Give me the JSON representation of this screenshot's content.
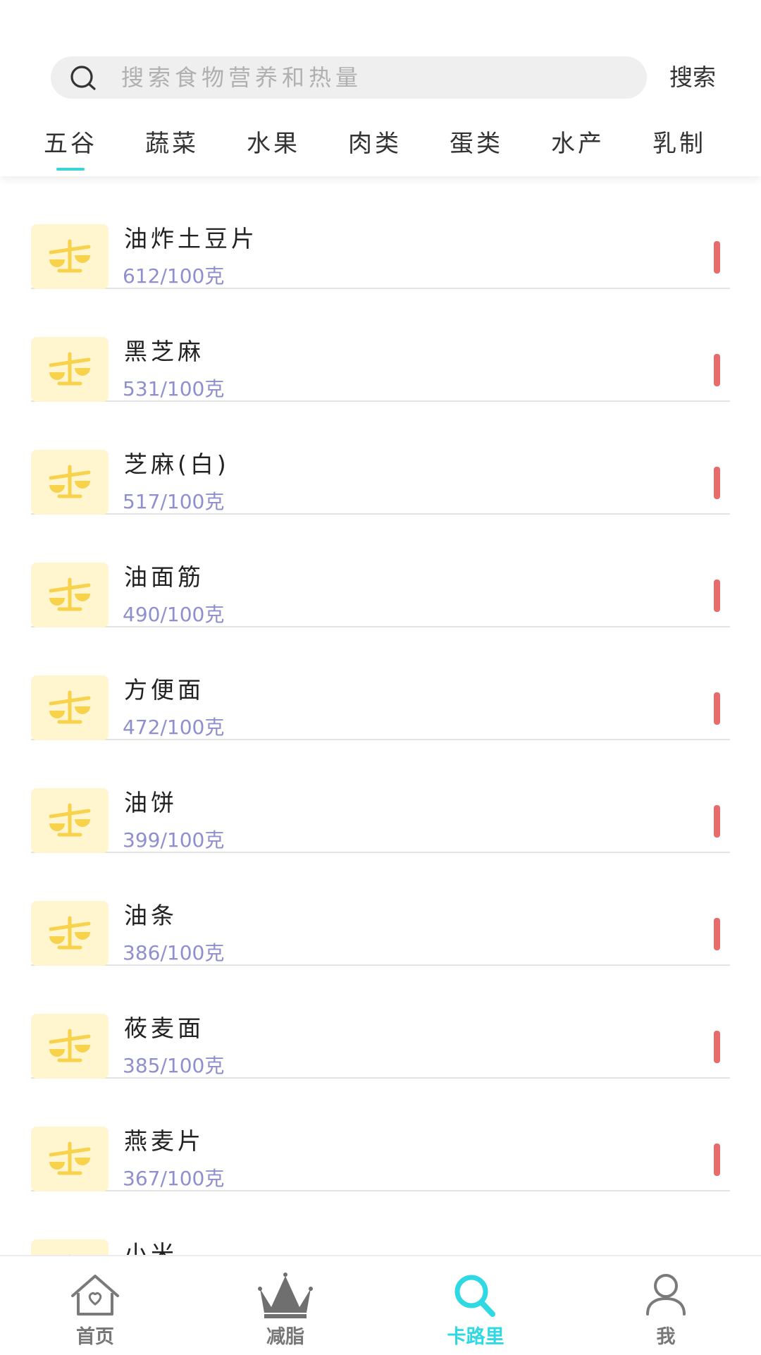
{
  "search": {
    "placeholder": "搜索食物营养和热量",
    "button_label": "搜索"
  },
  "tabs": [
    {
      "label": "五谷",
      "active": true
    },
    {
      "label": "蔬菜"
    },
    {
      "label": "水果"
    },
    {
      "label": "肉类"
    },
    {
      "label": "蛋类"
    },
    {
      "label": "水产"
    },
    {
      "label": "乳制"
    }
  ],
  "foods": [
    {
      "name": "油炸土豆片",
      "calories": "612/100克"
    },
    {
      "name": "黑芝麻",
      "calories": "531/100克"
    },
    {
      "name": "芝麻(白)",
      "calories": "517/100克"
    },
    {
      "name": "油面筋",
      "calories": "490/100克"
    },
    {
      "name": "方便面",
      "calories": "472/100克"
    },
    {
      "name": "油饼",
      "calories": "399/100克"
    },
    {
      "name": "油条",
      "calories": "386/100克"
    },
    {
      "name": "莜麦面",
      "calories": "385/100克"
    },
    {
      "name": "燕麦片",
      "calories": "367/100克"
    },
    {
      "name": "小米",
      "calories": ""
    }
  ],
  "icons": {
    "food_thumb": "balance-scale-icon",
    "level": "red-level-bar"
  },
  "colors": {
    "accent": "#2fd9e3",
    "calorie_text": "#8f8fce",
    "level_bar": "#e86a6a",
    "thumb_bg": "#fff5cf",
    "scale_icon": "#f7d24a"
  },
  "bottom_nav": [
    {
      "label": "首页",
      "icon": "home-heart-icon"
    },
    {
      "label": "减脂",
      "icon": "crown-icon"
    },
    {
      "label": "卡路里",
      "icon": "search-icon",
      "active": true
    },
    {
      "label": "我",
      "icon": "user-icon"
    }
  ]
}
